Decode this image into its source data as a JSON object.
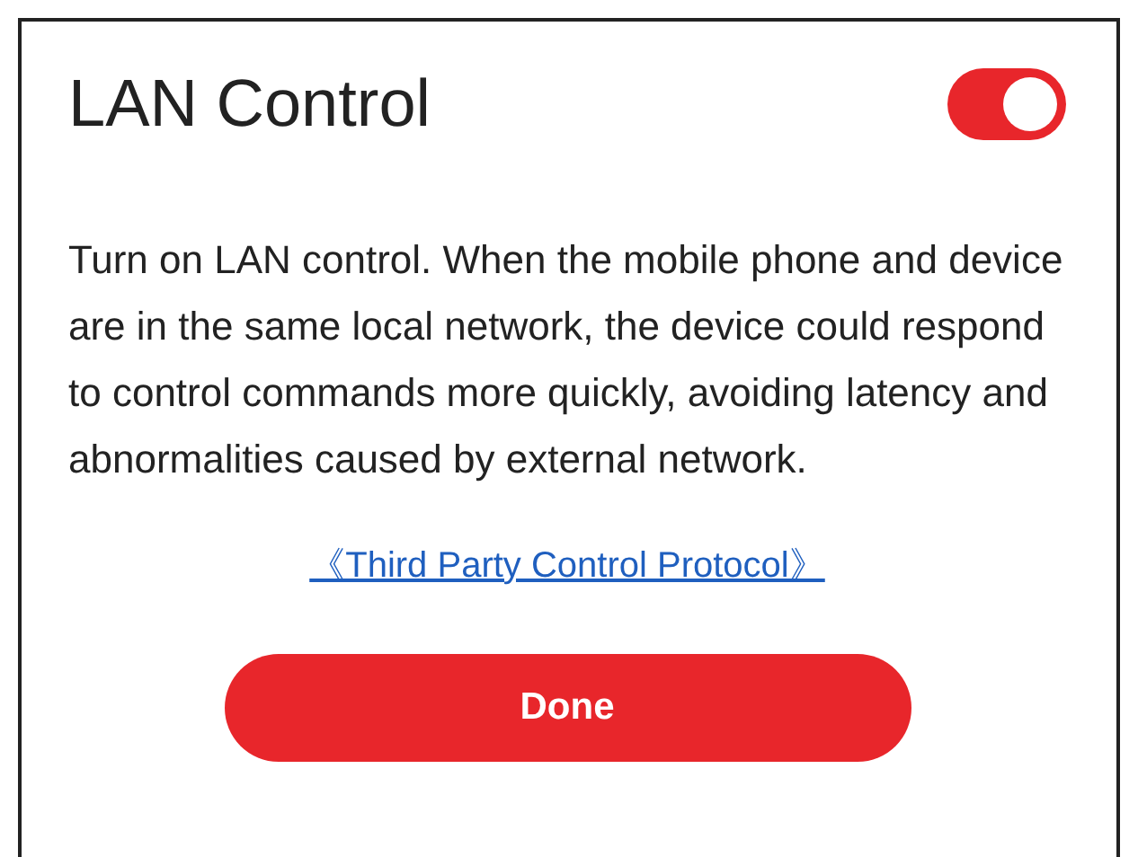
{
  "title": "LAN Control",
  "toggle": {
    "on": true
  },
  "description": "Turn on LAN control. When the mobile phone and device are in the same local network, the device could respond to control commands more quickly, avoiding latency and abnormalities caused by external network.",
  "link": "《Third Party Control Protocol》",
  "button": "Done"
}
